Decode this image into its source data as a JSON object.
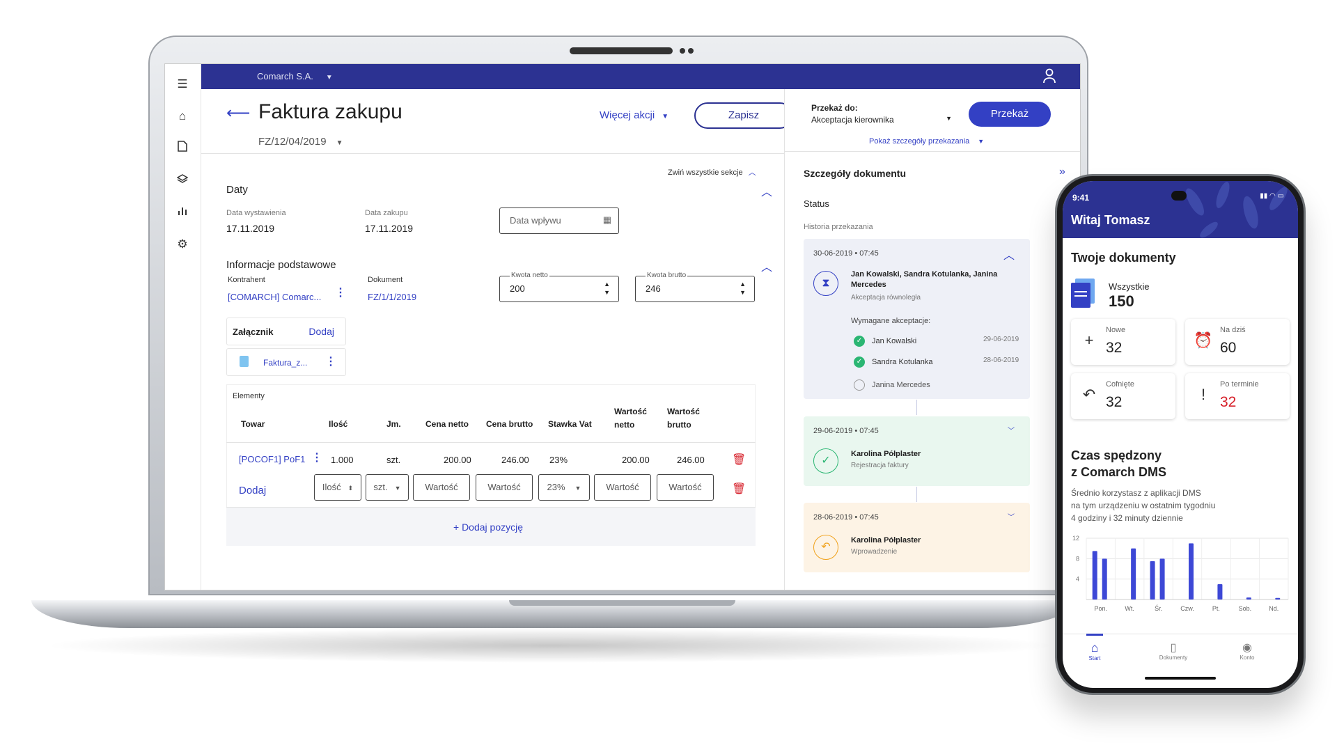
{
  "app": {
    "company": "Comarch S.A.",
    "title": "Faktura zakupu",
    "doc_number": "FZ/12/04/2019",
    "more_actions": "Więcej akcji",
    "save": "Zapisz",
    "transfer_to_label": "Przekaż do:",
    "transfer_to_value": "Akceptacja kierownika",
    "transfer_button": "Przekaż",
    "show_transfer_details": "Pokaż szczegóły przekazania",
    "collapse_all": "Zwiń wszystkie sekcje"
  },
  "dates": {
    "section": "Daty",
    "issue_label": "Data wystawienia",
    "issue_value": "17.11.2019",
    "purchase_label": "Data zakupu",
    "purchase_value": "17.11.2019",
    "receipt_placeholder": "Data wpływu"
  },
  "basic": {
    "section": "Informacje podstawowe",
    "contractor_label": "Kontrahent",
    "contractor_value": "[COMARCH] Comarc...",
    "document_label": "Dokument",
    "document_value": "FZ/1/1/2019",
    "net_label": "Kwota netto",
    "net_value": "200",
    "gross_label": "Kwota brutto",
    "gross_value": "246",
    "attachment_label": "Załącznik",
    "attachment_add": "Dodaj",
    "attachment_file": "Faktura_z..."
  },
  "elements": {
    "section": "Elementy",
    "headers": [
      "Towar",
      "Ilość",
      "Jm.",
      "Cena netto",
      "Cena brutto",
      "Stawka Vat",
      "Wartość netto",
      "Wartość brutto"
    ],
    "row": [
      "[POCOF1] PoF1",
      "1.000",
      "szt.",
      "200.00",
      "246.00",
      "23%",
      "200.00",
      "246.00"
    ],
    "add_row": {
      "add": "Dodaj",
      "qty": "Ilość",
      "unit": "szt.",
      "net": "Wartość",
      "gross": "Wartość",
      "vat": "23%",
      "val_net": "Wartość",
      "val_gross": "Wartość"
    },
    "add_position": "+ Dodaj pozycję"
  },
  "details": {
    "title": "Szczegóły dokumentu",
    "status": "Status",
    "history": "Historia przekazania",
    "cards": [
      {
        "date": "30-06-2019 • 07:45",
        "names": "Jan Kowalski, Sandra Kotulanka, Janina Mercedes",
        "type": "Akceptacja równoległa",
        "required": "Wymagane akceptacje:",
        "approvals": [
          {
            "name": "Jan Kowalski",
            "date": "29-06-2019"
          },
          {
            "name": "Sandra Kotulanka",
            "date": "28-06-2019"
          },
          {
            "name": "Janina Mercedes",
            "date": ""
          }
        ]
      },
      {
        "date": "29-06-2019 • 07:45",
        "names": "Karolina Półplaster",
        "type": "Rejestracja faktury"
      },
      {
        "date": "28-06-2019 • 07:45",
        "names": "Karolina Półplaster",
        "type": "Wprowadzenie"
      }
    ]
  },
  "phone": {
    "time": "9:41",
    "greeting": "Witaj Tomasz",
    "your_docs": "Twoje dokumenty",
    "all_label": "Wszystkie",
    "all_value": "150",
    "tiles": [
      {
        "label": "Nowe",
        "value": "32",
        "icon": "plus-icon"
      },
      {
        "label": "Na dziś",
        "value": "60",
        "icon": "alarm-clock-icon"
      },
      {
        "label": "Cofnięte",
        "value": "32",
        "icon": "undo-icon"
      },
      {
        "label": "Po terminie",
        "value": "32",
        "icon": "exclamation-icon",
        "color": "#d6202a"
      }
    ],
    "time_title_1": "Czas spędzony",
    "time_title_2": "z Comarch DMS",
    "time_desc_1": "Średnio korzystasz z aplikacji DMS",
    "time_desc_2": "na tym urządzeniu w ostatnim tygodniu",
    "time_desc_3": "4 godziny i 32 minuty dziennie",
    "nav": [
      "Start",
      "Dokumenty",
      "Konto"
    ]
  },
  "chart_data": {
    "type": "bar",
    "categories": [
      "Pon.",
      "Wt.",
      "Śr.",
      "Czw.",
      "Pt.",
      "Sob.",
      "Nd."
    ],
    "series": [
      {
        "values": [
          8,
          10,
          8,
          11,
          3,
          0.4,
          0.3
        ]
      },
      {
        "values": [
          9.5,
          0,
          7.5,
          0,
          0,
          0,
          0
        ]
      }
    ],
    "ylim": [
      0,
      12
    ],
    "yticks": [
      "12",
      "8",
      "4"
    ],
    "color": "#3d48d6"
  },
  "colors": {
    "topbar": "#2c3292",
    "accent": "#3340c4",
    "green": "#2bb673",
    "orange": "#f0a21c",
    "red": "#d6202a"
  }
}
